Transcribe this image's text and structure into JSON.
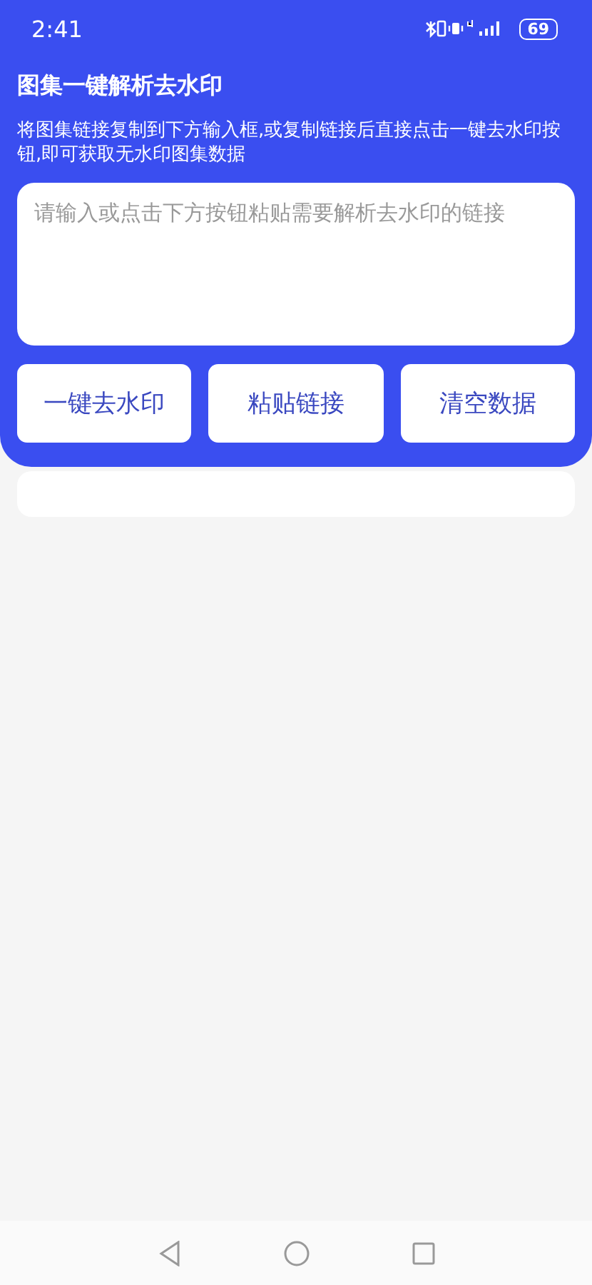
{
  "status_bar": {
    "time": "2:41",
    "battery": "69"
  },
  "header": {
    "title": "图集一键解析去水印",
    "description": "将图集链接复制到下方输入框,或复制链接后直接点击一键去水印按钮,即可获取无水印图集数据"
  },
  "input": {
    "placeholder": "请输入或点击下方按钮粘贴需要解析去水印的链接"
  },
  "buttons": [
    {
      "label": "一键去水印"
    },
    {
      "label": "粘贴链接"
    },
    {
      "label": "清空数据"
    }
  ]
}
